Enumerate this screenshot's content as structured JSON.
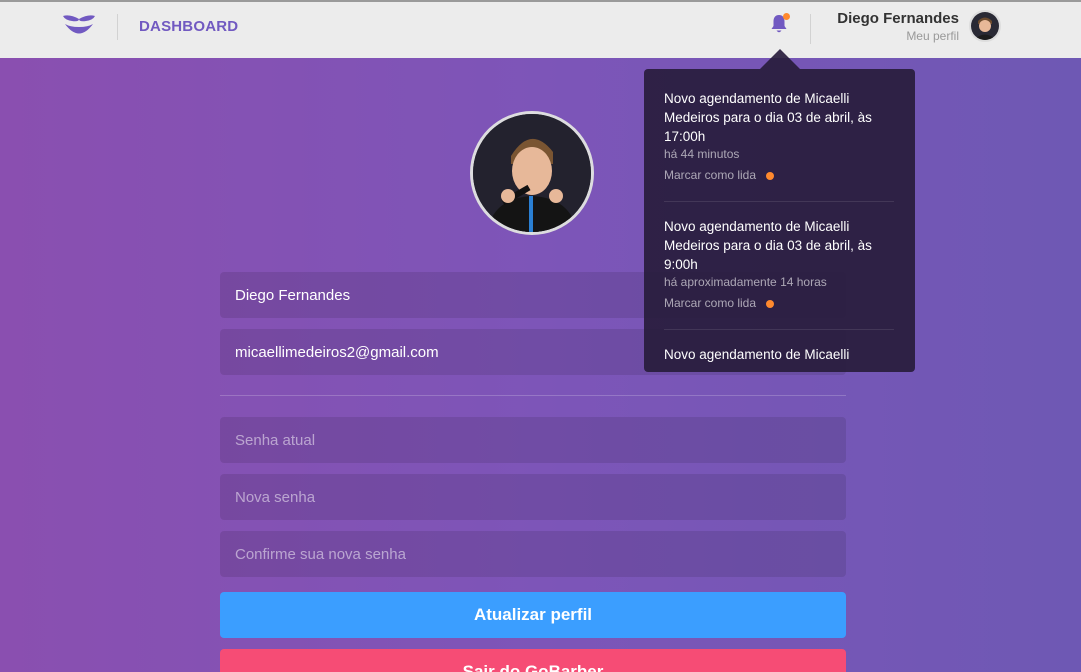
{
  "colors": {
    "accent": "#7159c1",
    "unread": "#ff892e",
    "update_button": "#3b9eff",
    "logout_button": "#f64c75"
  },
  "header": {
    "logo_icon": "gobarber-mustache-icon",
    "dashboard_label": "DASHBOARD",
    "notification_icon": "bell-icon",
    "profile_name": "Diego Fernandes",
    "profile_link": "Meu perfil"
  },
  "notifications": [
    {
      "text": "Novo agendamento de Micaelli Medeiros para o dia 03 de abril, às 17:00h",
      "time": "há 44 minutos",
      "mark_label": "Marcar como lida",
      "unread": true
    },
    {
      "text": "Novo agendamento de Micaelli Medeiros para o dia 03 de abril, às 9:00h",
      "time": "há aproximadamente 14 horas",
      "mark_label": "Marcar como lida",
      "unread": true
    },
    {
      "text": "Novo agendamento de Micaelli",
      "time": "",
      "mark_label": "",
      "unread": true
    }
  ],
  "profile_form": {
    "name_value": "Diego Fernandes",
    "email_value": "micaellimedeiros2@gmail.com",
    "current_password_placeholder": "Senha atual",
    "new_password_placeholder": "Nova senha",
    "confirm_password_placeholder": "Confirme sua nova senha",
    "update_button": "Atualizar perfil",
    "logout_button": "Sair do GoBarber"
  }
}
